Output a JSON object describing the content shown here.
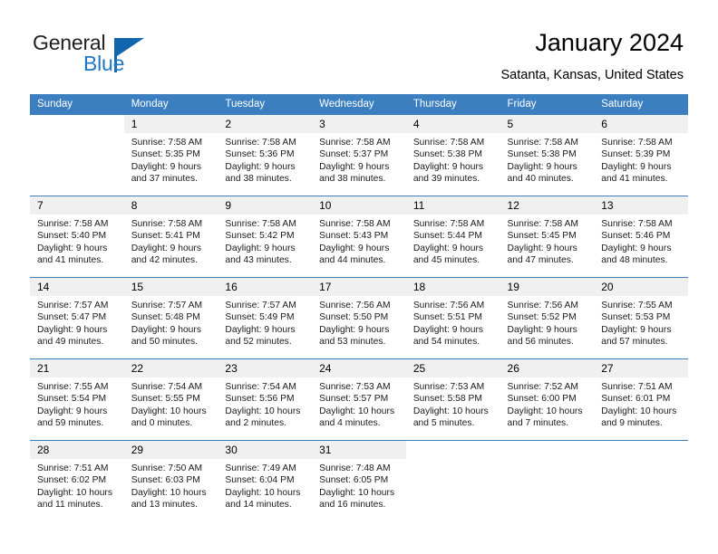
{
  "brand": {
    "name_part1": "General",
    "name_part2": "Blue",
    "triangle_color": "#1266ab",
    "text_color": "#231f20",
    "accent_color": "#1f76c4"
  },
  "header": {
    "title": "January 2024",
    "subtitle": "Satanta, Kansas, United States",
    "header_bg_color": "#3c7fc1",
    "daynum_bg_color": "#f0f0f0"
  },
  "weekdays": [
    "Sunday",
    "Monday",
    "Tuesday",
    "Wednesday",
    "Thursday",
    "Friday",
    "Saturday"
  ],
  "weeks": [
    [
      {
        "day": "",
        "info": ""
      },
      {
        "day": "1",
        "info": "Sunrise: 7:58 AM\nSunset: 5:35 PM\nDaylight: 9 hours\nand 37 minutes."
      },
      {
        "day": "2",
        "info": "Sunrise: 7:58 AM\nSunset: 5:36 PM\nDaylight: 9 hours\nand 38 minutes."
      },
      {
        "day": "3",
        "info": "Sunrise: 7:58 AM\nSunset: 5:37 PM\nDaylight: 9 hours\nand 38 minutes."
      },
      {
        "day": "4",
        "info": "Sunrise: 7:58 AM\nSunset: 5:38 PM\nDaylight: 9 hours\nand 39 minutes."
      },
      {
        "day": "5",
        "info": "Sunrise: 7:58 AM\nSunset: 5:38 PM\nDaylight: 9 hours\nand 40 minutes."
      },
      {
        "day": "6",
        "info": "Sunrise: 7:58 AM\nSunset: 5:39 PM\nDaylight: 9 hours\nand 41 minutes."
      }
    ],
    [
      {
        "day": "7",
        "info": "Sunrise: 7:58 AM\nSunset: 5:40 PM\nDaylight: 9 hours\nand 41 minutes."
      },
      {
        "day": "8",
        "info": "Sunrise: 7:58 AM\nSunset: 5:41 PM\nDaylight: 9 hours\nand 42 minutes."
      },
      {
        "day": "9",
        "info": "Sunrise: 7:58 AM\nSunset: 5:42 PM\nDaylight: 9 hours\nand 43 minutes."
      },
      {
        "day": "10",
        "info": "Sunrise: 7:58 AM\nSunset: 5:43 PM\nDaylight: 9 hours\nand 44 minutes."
      },
      {
        "day": "11",
        "info": "Sunrise: 7:58 AM\nSunset: 5:44 PM\nDaylight: 9 hours\nand 45 minutes."
      },
      {
        "day": "12",
        "info": "Sunrise: 7:58 AM\nSunset: 5:45 PM\nDaylight: 9 hours\nand 47 minutes."
      },
      {
        "day": "13",
        "info": "Sunrise: 7:58 AM\nSunset: 5:46 PM\nDaylight: 9 hours\nand 48 minutes."
      }
    ],
    [
      {
        "day": "14",
        "info": "Sunrise: 7:57 AM\nSunset: 5:47 PM\nDaylight: 9 hours\nand 49 minutes."
      },
      {
        "day": "15",
        "info": "Sunrise: 7:57 AM\nSunset: 5:48 PM\nDaylight: 9 hours\nand 50 minutes."
      },
      {
        "day": "16",
        "info": "Sunrise: 7:57 AM\nSunset: 5:49 PM\nDaylight: 9 hours\nand 52 minutes."
      },
      {
        "day": "17",
        "info": "Sunrise: 7:56 AM\nSunset: 5:50 PM\nDaylight: 9 hours\nand 53 minutes."
      },
      {
        "day": "18",
        "info": "Sunrise: 7:56 AM\nSunset: 5:51 PM\nDaylight: 9 hours\nand 54 minutes."
      },
      {
        "day": "19",
        "info": "Sunrise: 7:56 AM\nSunset: 5:52 PM\nDaylight: 9 hours\nand 56 minutes."
      },
      {
        "day": "20",
        "info": "Sunrise: 7:55 AM\nSunset: 5:53 PM\nDaylight: 9 hours\nand 57 minutes."
      }
    ],
    [
      {
        "day": "21",
        "info": "Sunrise: 7:55 AM\nSunset: 5:54 PM\nDaylight: 9 hours\nand 59 minutes."
      },
      {
        "day": "22",
        "info": "Sunrise: 7:54 AM\nSunset: 5:55 PM\nDaylight: 10 hours\nand 0 minutes."
      },
      {
        "day": "23",
        "info": "Sunrise: 7:54 AM\nSunset: 5:56 PM\nDaylight: 10 hours\nand 2 minutes."
      },
      {
        "day": "24",
        "info": "Sunrise: 7:53 AM\nSunset: 5:57 PM\nDaylight: 10 hours\nand 4 minutes."
      },
      {
        "day": "25",
        "info": "Sunrise: 7:53 AM\nSunset: 5:58 PM\nDaylight: 10 hours\nand 5 minutes."
      },
      {
        "day": "26",
        "info": "Sunrise: 7:52 AM\nSunset: 6:00 PM\nDaylight: 10 hours\nand 7 minutes."
      },
      {
        "day": "27",
        "info": "Sunrise: 7:51 AM\nSunset: 6:01 PM\nDaylight: 10 hours\nand 9 minutes."
      }
    ],
    [
      {
        "day": "28",
        "info": "Sunrise: 7:51 AM\nSunset: 6:02 PM\nDaylight: 10 hours\nand 11 minutes."
      },
      {
        "day": "29",
        "info": "Sunrise: 7:50 AM\nSunset: 6:03 PM\nDaylight: 10 hours\nand 13 minutes."
      },
      {
        "day": "30",
        "info": "Sunrise: 7:49 AM\nSunset: 6:04 PM\nDaylight: 10 hours\nand 14 minutes."
      },
      {
        "day": "31",
        "info": "Sunrise: 7:48 AM\nSunset: 6:05 PM\nDaylight: 10 hours\nand 16 minutes."
      },
      {
        "day": "",
        "info": ""
      },
      {
        "day": "",
        "info": ""
      },
      {
        "day": "",
        "info": ""
      }
    ]
  ]
}
